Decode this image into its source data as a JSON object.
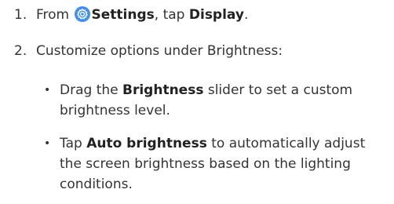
{
  "steps": [
    {
      "number": "1.",
      "prefix": "From",
      "settings_label": "Settings",
      "middle": ", tap",
      "display_label": "Display",
      "suffix": "."
    },
    {
      "number": "2.",
      "text": "Customize options under Brightness:"
    }
  ],
  "bullets": [
    {
      "symbol": "•",
      "line1_pre": "Drag the",
      "line1_bold": "Brightness",
      "line1_post": "slider to set a custom",
      "line2": "brightness level."
    },
    {
      "symbol": "•",
      "line1_pre": "Tap",
      "line1_bold": "Auto brightness",
      "line1_post": "to automatically adjust",
      "line2": "the screen brightness based on the lighting",
      "line3": "conditions."
    }
  ],
  "icons": {
    "settings": "gear-icon"
  },
  "colors": {
    "settings_icon": "#3f8ef0",
    "text": "#333333"
  }
}
